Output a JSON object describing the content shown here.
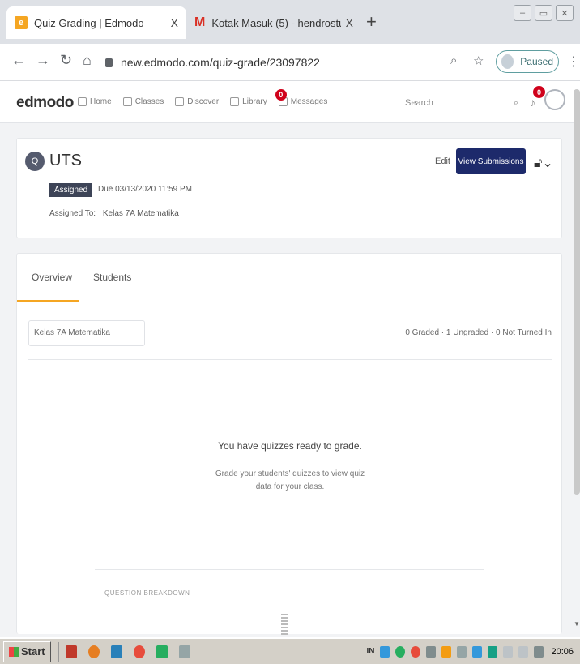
{
  "browser": {
    "tabs": [
      {
        "title": "Quiz Grading | Edmodo",
        "close": "X",
        "favicon": "e"
      },
      {
        "title": "Kotak Masuk (5) - hendrostuden",
        "close": "X",
        "favicon": "M"
      }
    ],
    "new_tab": "+",
    "url": "new.edmodo.com/quiz-grade/23097822",
    "profile_status": "Paused",
    "window_controls": [
      "–",
      "▭",
      "✕"
    ]
  },
  "edmodo_nav": {
    "logo": "edmodo",
    "items": [
      "Home",
      "Classes",
      "Discover",
      "Library",
      "Messages"
    ],
    "messages_badge": "0",
    "search_placeholder": "Search",
    "notifications_badge": "0"
  },
  "assignment": {
    "title": "UTS",
    "icon_letter": "Q",
    "status": "Assigned",
    "due": "Due 03/13/2020 11:59 PM",
    "assigned_to_label": "Assigned To:",
    "assigned_to_group": "Kelas 7A Matematika",
    "edit_label": "Edit",
    "view_submissions_label": "View Submissions",
    "lock_caret": "⌄"
  },
  "tabs": {
    "overview": "Overview",
    "students": "Students"
  },
  "filters": {
    "class_select": "Kelas 7A Matematika",
    "stats": "0 Graded · 1 Ungraded · 0 Not Turned In"
  },
  "empty_state": {
    "title": "You have quizzes ready to grade.",
    "subtitle": "Grade your students' quizzes to view quiz data for your class."
  },
  "section_label": "QUESTION BREAKDOWN",
  "taskbar": {
    "start": "Start",
    "tray_label": "IN",
    "clock": "20:06"
  },
  "colors": {
    "accent_orange": "#f5a623",
    "primary_navy": "#1d2a6b",
    "badge_red": "#d0021b"
  }
}
